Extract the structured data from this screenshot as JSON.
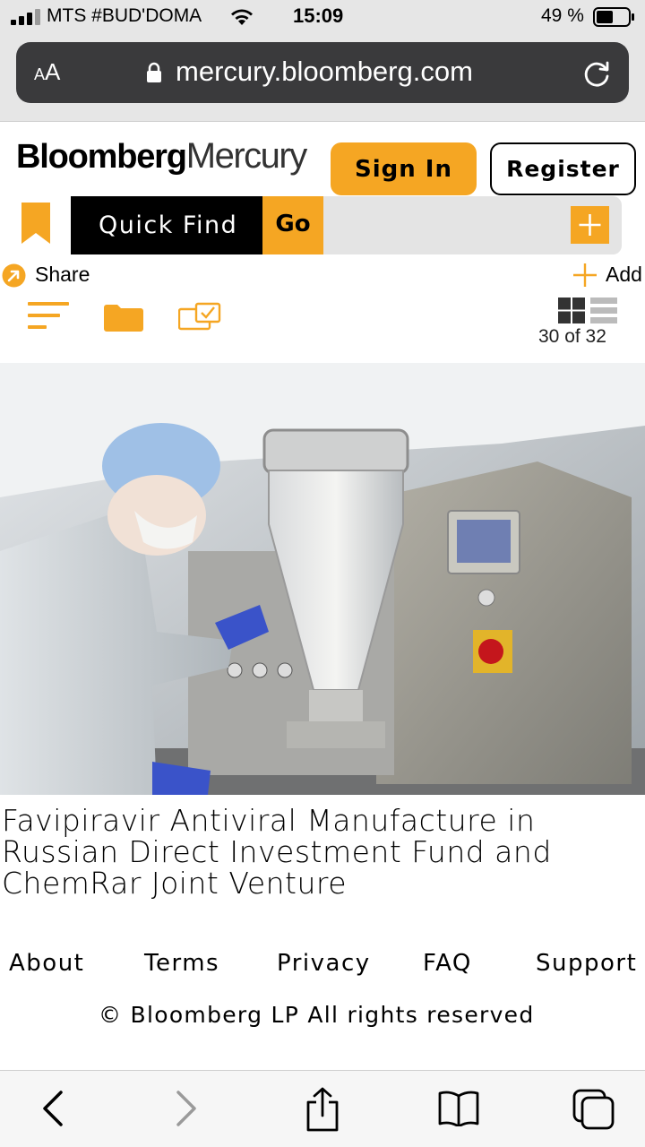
{
  "status_bar": {
    "carrier": "MTS #BUD'DOMA",
    "time": "15:09",
    "battery": "49 %"
  },
  "browser": {
    "text_size_label_small": "A",
    "text_size_label_large": "A",
    "url": "mercury.bloomberg.com"
  },
  "header": {
    "logo_primary": "Bloomberg",
    "logo_secondary": "Mercury",
    "sign_in": "Sign In",
    "register": "Register"
  },
  "quick_find": {
    "label": "Quick Find",
    "go": "Go",
    "field_value": ""
  },
  "actions": {
    "share": "Share",
    "add": "Add",
    "counter": "30 of 32"
  },
  "colors": {
    "accent": "#f5a623",
    "black": "#000000",
    "field_gray": "#e4e4e4"
  },
  "article": {
    "caption": "Favipiravir Antiviral Manufacture in Russian Direct Investment Fund and ChemRar Joint Venture"
  },
  "footer": {
    "links": [
      "About",
      "Terms",
      "Privacy",
      "FAQ",
      "Support"
    ],
    "copyright": "© Bloomberg LP All rights reserved"
  },
  "icons": {
    "signal": "signal-icon",
    "wifi": "wifi-icon",
    "battery": "battery-icon",
    "lock": "lock-icon",
    "reload": "reload-icon",
    "bookmark": "bookmark-icon",
    "plus": "plus-icon",
    "share": "share-arrow-icon",
    "sort": "sort-lines-icon",
    "folder": "folder-icon",
    "select": "multi-select-icon",
    "grid": "grid-view-icon",
    "list": "list-view-icon",
    "back": "back-icon",
    "forward": "forward-icon",
    "share_sheet": "share-sheet-icon",
    "bookmarks": "book-icon",
    "tabs": "tabs-icon"
  }
}
